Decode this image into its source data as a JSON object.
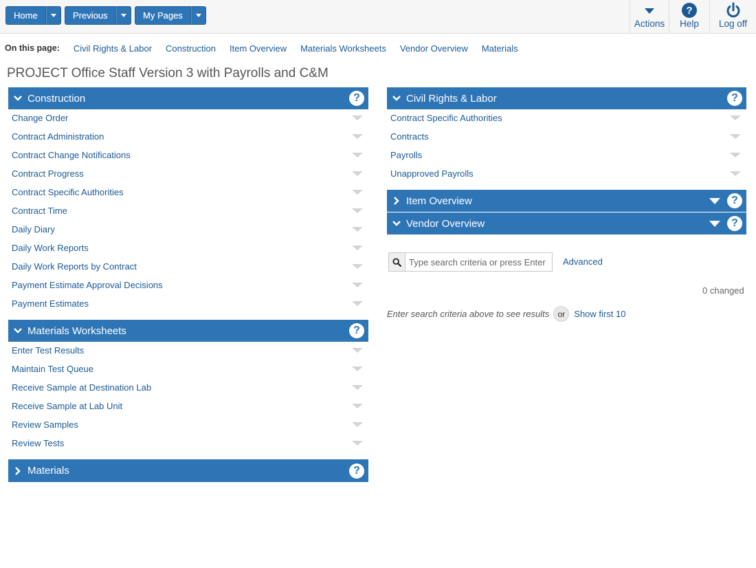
{
  "toolbar": {
    "home_label": "Home",
    "previous_label": "Previous",
    "mypages_label": "My Pages",
    "actions_label": "Actions",
    "help_label": "Help",
    "logoff_label": "Log off"
  },
  "on_this_page": {
    "label": "On this page:",
    "links": [
      "Civil Rights & Labor",
      "Construction",
      "Item Overview",
      "Materials Worksheets",
      "Vendor Overview",
      "Materials"
    ]
  },
  "page_title": "PROJECT Office Staff Version 3 with Payrolls and C&M",
  "panels": {
    "construction": {
      "title": "Construction",
      "items": [
        "Change Order",
        "Contract Administration",
        "Contract Change Notifications",
        "Contract Progress",
        "Contract Specific Authorities",
        "Contract Time",
        "Daily Diary",
        "Daily Work Reports",
        "Daily Work Reports by Contract",
        "Payment Estimate Approval Decisions",
        "Payment Estimates"
      ]
    },
    "materials_worksheets": {
      "title": "Materials Worksheets",
      "items": [
        "Enter Test Results",
        "Maintain Test Queue",
        "Receive Sample at Destination Lab",
        "Receive Sample at Lab Unit",
        "Review Samples",
        "Review Tests"
      ]
    },
    "materials": {
      "title": "Materials"
    },
    "civil_rights": {
      "title": "Civil Rights & Labor",
      "items": [
        "Contract Specific Authorities",
        "Contracts",
        "Payrolls",
        "Unapproved Payrolls"
      ]
    },
    "item_overview": {
      "title": "Item Overview"
    },
    "vendor_overview": {
      "title": "Vendor Overview"
    }
  },
  "vendor_search": {
    "placeholder": "Type search criteria or press Enter",
    "advanced_label": "Advanced",
    "changed_text": "0 changed",
    "hint_text": "Enter search criteria above to see results",
    "or_label": "or",
    "show_first_label": "Show first 10"
  },
  "colors": {
    "accent": "#2e75b6",
    "link": "#1c5a96"
  }
}
